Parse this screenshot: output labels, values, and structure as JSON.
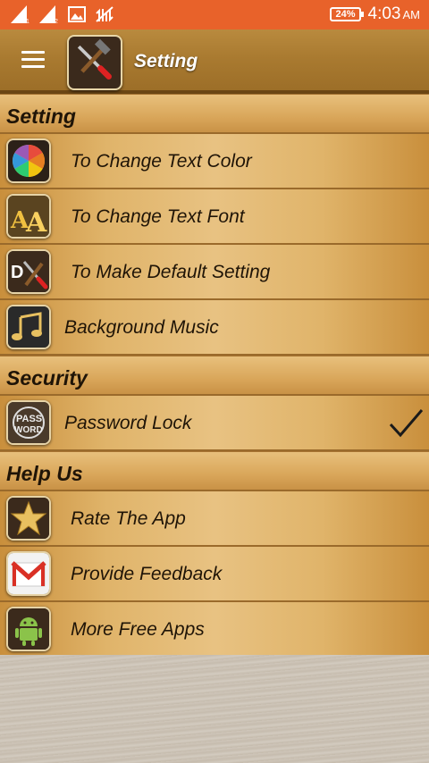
{
  "status_bar": {
    "battery": "24%",
    "time": "4:03",
    "ampm": "AM",
    "icons": [
      "signal-1-icon",
      "signal-2-icon",
      "image-icon",
      "data-off-icon"
    ]
  },
  "app_bar": {
    "title": "Setting",
    "menu_icon": "hamburger-menu-icon",
    "logo_icon": "tools-hammer-screwdriver-icon"
  },
  "sections": {
    "setting": {
      "header": "Setting",
      "items": [
        {
          "label": "To Change Text Color",
          "icon": "color-wheel-icon"
        },
        {
          "label": "To Change Text Font",
          "icon": "font-aa-icon"
        },
        {
          "label": "To Make Default Setting",
          "icon": "default-tools-icon"
        },
        {
          "label": "Background Music",
          "icon": "music-note-icon"
        }
      ]
    },
    "security": {
      "header": "Security",
      "items": [
        {
          "label": "Password Lock",
          "icon": "password-icon",
          "checked": true
        }
      ]
    },
    "help": {
      "header": "Help Us",
      "items": [
        {
          "label": "Rate The App",
          "icon": "star-icon"
        },
        {
          "label": "Provide Feedback",
          "icon": "gmail-icon"
        },
        {
          "label": "More Free Apps",
          "icon": "android-icon"
        }
      ]
    }
  },
  "colors": {
    "status_bar": "#e8622a",
    "app_bar": "#a97a30",
    "row_light": "#e8c282",
    "row_dark": "#c98f3c",
    "text": "#1f1407"
  }
}
